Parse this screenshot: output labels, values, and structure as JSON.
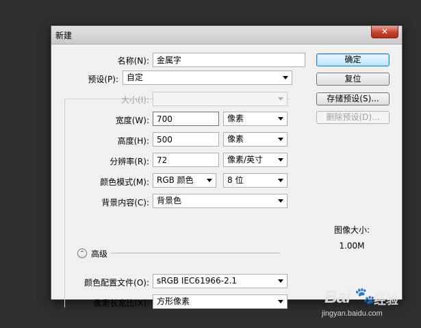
{
  "window": {
    "title": "新建",
    "close_glyph": "✕"
  },
  "fields": {
    "name": {
      "label": "名称(N):",
      "value": "金属字"
    },
    "preset": {
      "label": "预设(P):",
      "value": "自定"
    },
    "size": {
      "label": "大小(I):",
      "value": ""
    },
    "width": {
      "label": "宽度(W):",
      "value": "700",
      "unit": "像素"
    },
    "height": {
      "label": "高度(H):",
      "value": "500",
      "unit": "像素"
    },
    "resolution": {
      "label": "分辨率(R):",
      "value": "72",
      "unit": "像素/英寸"
    },
    "color_mode": {
      "label": "颜色模式(M):",
      "value": "RGB 颜色",
      "depth": "8 位"
    },
    "background": {
      "label": "背景内容(C):",
      "value": "背景色"
    },
    "advanced": {
      "label": "高级",
      "toggle_glyph": "⌃"
    },
    "color_profile": {
      "label": "颜色配置文件(O):",
      "value": "sRGB IEC61966-2.1"
    },
    "pixel_aspect": {
      "label": "像素长宽比(X):",
      "value": "方形像素"
    }
  },
  "buttons": {
    "ok": "确定",
    "reset": "复位",
    "save_preset": "存储预设(S)...",
    "delete_preset": "删除预设(D)..."
  },
  "image_size": {
    "label": "图像大小:",
    "value": "1.00M"
  },
  "watermark": {
    "logo": "Bai",
    "paw": "🐾",
    "cn": "经验",
    "url": "jingyan.baidu.com"
  }
}
